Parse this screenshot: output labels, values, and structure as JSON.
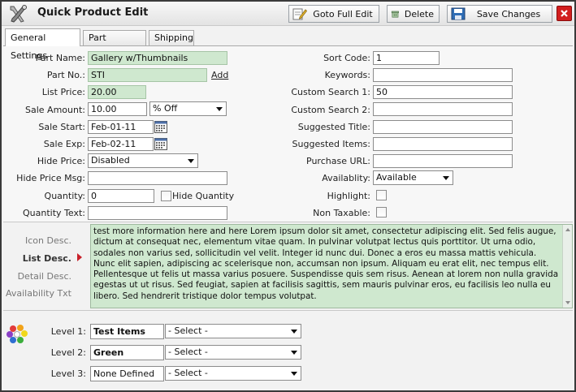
{
  "window": {
    "title": "Quick Product Edit"
  },
  "toolbar": {
    "goto_full_edit": "Goto Full Edit",
    "delete": "Delete",
    "save_changes": "Save Changes"
  },
  "tabs": [
    {
      "label": "General Settings",
      "active": true
    },
    {
      "label": "Part Options",
      "active": false
    },
    {
      "label": "Shipping",
      "active": false
    }
  ],
  "form": {
    "part_name": {
      "label": "Part Name:",
      "value": "Gallery w/Thumbnails"
    },
    "part_no": {
      "label": "Part No.:",
      "value": "STI",
      "add_link": "Add"
    },
    "list_price": {
      "label": "List Price:",
      "value": "20.00"
    },
    "sale_amount": {
      "label": "Sale Amount:",
      "value": "10.00",
      "type_value": "% Off"
    },
    "sale_start": {
      "label": "Sale Start:",
      "value": "Feb-01-11"
    },
    "sale_exp": {
      "label": "Sale Exp:",
      "value": "Feb-02-11"
    },
    "hide_price": {
      "label": "Hide Price:",
      "value": "Disabled"
    },
    "hide_price_msg": {
      "label": "Hide Price Msg:",
      "value": ""
    },
    "quantity": {
      "label": "Quantity:",
      "value": "0",
      "hide_quantity_label": "Hide Quantity"
    },
    "quantity_text": {
      "label": "Quantity Text:",
      "value": ""
    },
    "sort_code": {
      "label": "Sort Code:",
      "value": "1"
    },
    "keywords": {
      "label": "Keywords:",
      "value": ""
    },
    "custom_search_1": {
      "label": "Custom Search 1:",
      "value": "50"
    },
    "custom_search_2": {
      "label": "Custom Search 2:",
      "value": ""
    },
    "suggested_title": {
      "label": "Suggested Title:",
      "value": ""
    },
    "suggested_items": {
      "label": "Suggested Items:",
      "value": ""
    },
    "purchase_url": {
      "label": "Purchase URL:",
      "value": ""
    },
    "availability": {
      "label": "Availablity:",
      "value": "Available"
    },
    "highlight": {
      "label": "Highlight:",
      "checked": false
    },
    "non_taxable": {
      "label": "Non Taxable:",
      "checked": false
    }
  },
  "description": {
    "tabs": [
      "Icon Desc.",
      "List Desc.",
      "Detail Desc.",
      "Availability Txt"
    ],
    "active_tab": "List Desc.",
    "text": "test more information here and here Lorem ipsum dolor sit amet, consectetur adipiscing elit. Sed felis augue, dictum at consequat nec, elementum vitae quam. In pulvinar volutpat lectus quis porttitor. Ut urna odio, sodales non varius sed, sollicitudin vel velit. Integer id nunc dui. Donec a eros eu massa mattis vehicula. Nunc elit sapien, adipiscing ac scelerisque non, accumsan non ipsum. Aliquam eu erat elit, nec tempus elit. Pellentesque ut felis ut massa varius posuere. Suspendisse quis sem risus. Aenean at lorem non nulla gravida egestas ut ut risus. Sed feugiat, sapien at facilisis sagittis, sem mauris pulvinar eros, eu facilisis leo nulla eu libero. Sed hendrerit tristique dolor tempus volutpat."
  },
  "levels": [
    {
      "label": "Level 1:",
      "value": "Test Items",
      "select": "- Select -"
    },
    {
      "label": "Level 2:",
      "value": "Green",
      "select": "- Select -"
    },
    {
      "label": "Level 3:",
      "value": "None Defined",
      "select": "- Select -"
    }
  ],
  "colors": {
    "field_green": "#cfe8cf",
    "close_red": "#d21f1f",
    "arrow_red": "#c8202a"
  }
}
